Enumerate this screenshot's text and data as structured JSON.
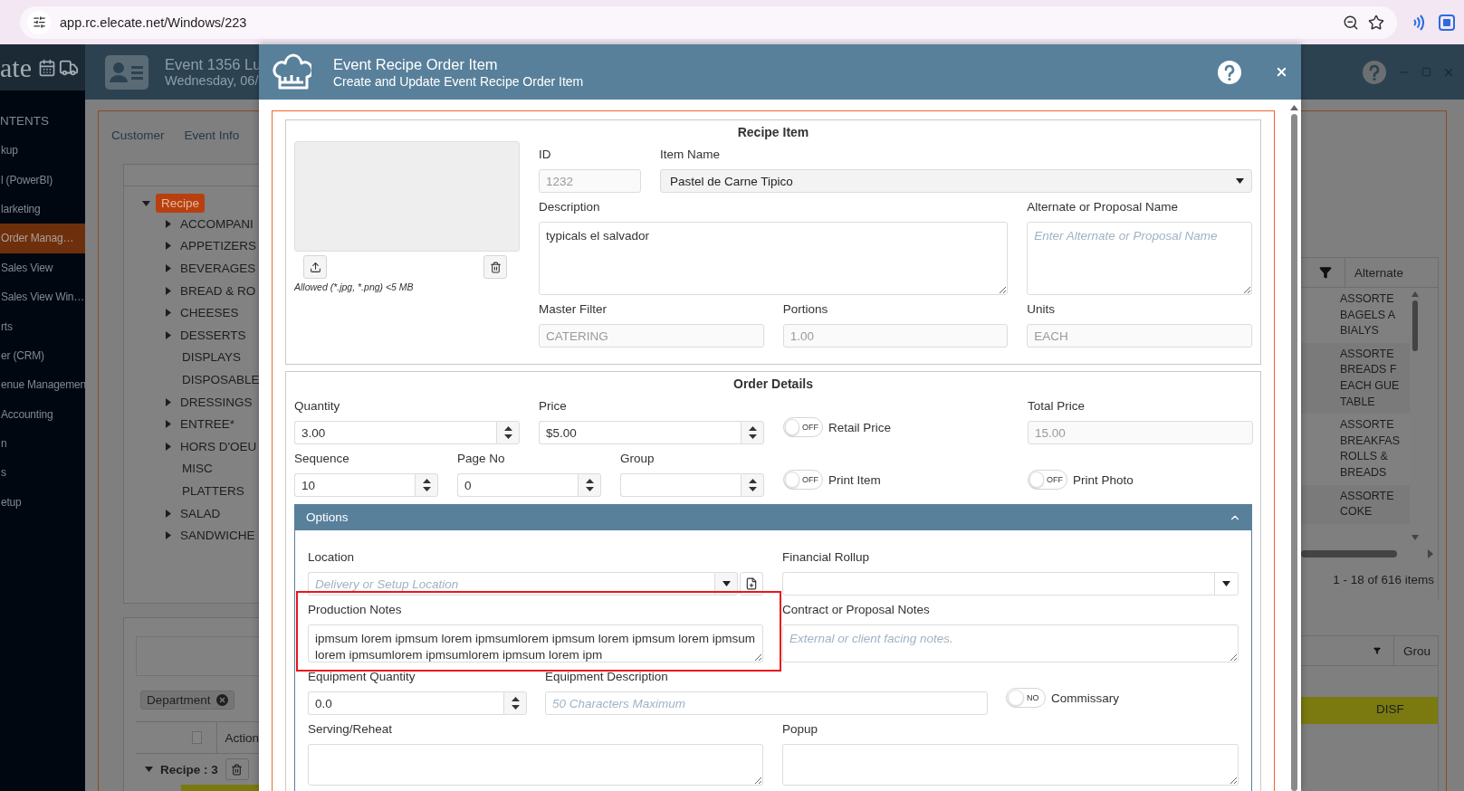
{
  "browser": {
    "url": "app.rc.elecate.net/Windows/223"
  },
  "app": {
    "logo": "ate",
    "event_title": "Event 1356 Lu",
    "event_date": "Wednesday, 06/"
  },
  "sidebar": {
    "heading": "NTENTS",
    "items": [
      {
        "label": "kup",
        "selected": false
      },
      {
        "label": "l (PowerBI)",
        "selected": false
      },
      {
        "label": "larketing",
        "selected": false
      },
      {
        "label": "Order Manag…",
        "selected": true
      },
      {
        "label": "Sales View",
        "selected": false
      },
      {
        "label": "Sales View Win…",
        "selected": false
      },
      {
        "label": "rts",
        "selected": false
      },
      {
        "label": "er (CRM)",
        "selected": false
      },
      {
        "label": "enue Managemen",
        "selected": false
      },
      {
        "label": "Accounting",
        "selected": false
      },
      {
        "label": "n",
        "selected": false
      },
      {
        "label": "s",
        "selected": false
      },
      {
        "label": "etup",
        "selected": false
      }
    ]
  },
  "tabs": [
    {
      "label": "Customer"
    },
    {
      "label": "Event Info"
    }
  ],
  "tree": {
    "label": "Recipe",
    "selected": true,
    "expanded": true,
    "children": [
      {
        "label": "ACCOMPANI",
        "expandable": true
      },
      {
        "label": "APPETIZERS",
        "expandable": true
      },
      {
        "label": "BEVERAGES",
        "expandable": true
      },
      {
        "label": "BREAD & RO",
        "expandable": true
      },
      {
        "label": "CHEESES",
        "expandable": true
      },
      {
        "label": "DESSERTS",
        "expandable": true
      },
      {
        "label": "DISPLAYS",
        "expandable": false
      },
      {
        "label": "DISPOSABLE",
        "expandable": false
      },
      {
        "label": "DRESSINGS",
        "expandable": true
      },
      {
        "label": "ENTREE*",
        "expandable": true
      },
      {
        "label": "HORS D'OEU",
        "expandable": true
      },
      {
        "label": "MISC",
        "expandable": false
      },
      {
        "label": "PLATTERS",
        "expandable": false
      },
      {
        "label": "SALAD",
        "expandable": true
      },
      {
        "label": "SANDWICHE",
        "expandable": true
      }
    ]
  },
  "lower_grid": {
    "filter_chip": "Department",
    "checked": false,
    "column": "Action",
    "group_row": "Recipe : 3"
  },
  "right_grid": {
    "column": "Alternate",
    "rows": [
      {
        "lines": [
          "ASSORTE",
          "BAGELS A",
          "BIALYS"
        ]
      },
      {
        "lines": [
          "ASSORTE",
          "BREADS F",
          "EACH GUE",
          "TABLE"
        ]
      },
      {
        "lines": [
          "ASSORTE",
          "BREAKFAS",
          "ROLLS &",
          "BREADS"
        ]
      },
      {
        "lines": [
          "ASSORTE",
          "COKE"
        ]
      }
    ],
    "pager": "1 - 18 of 616 items",
    "lower_column": "Grou",
    "lower_cell": "DISF"
  },
  "modal": {
    "title": "Event Recipe Order Item",
    "subtitle": "Create and Update Event Recipe Order Item",
    "recipe_item": {
      "heading": "Recipe Item",
      "image_hint": "Allowed (*.jpg, *.png) <5 MB",
      "id": {
        "label": "ID",
        "value": "1232",
        "disabled": true
      },
      "item_name": {
        "label": "Item Name",
        "value": "Pastel de Carne Tipico"
      },
      "description": {
        "label": "Description",
        "value": "typicals el salvador"
      },
      "alternate_name": {
        "label": "Alternate or Proposal Name",
        "placeholder": "Enter Alternate or Proposal Name"
      },
      "master_filter": {
        "label": "Master Filter",
        "value": "CATERING",
        "disabled": true
      },
      "portions": {
        "label": "Portions",
        "value": "1.00",
        "disabled": true
      },
      "units": {
        "label": "Units",
        "value": "EACH",
        "disabled": true
      }
    },
    "order_details": {
      "heading": "Order Details",
      "quantity": {
        "label": "Quantity",
        "value": "3.00"
      },
      "price": {
        "label": "Price",
        "value": "$5.00"
      },
      "retail_price": {
        "label": "Retail Price",
        "state": "OFF",
        "on": false
      },
      "total_price": {
        "label": "Total Price",
        "value": "15.00",
        "disabled": true
      },
      "sequence": {
        "label": "Sequence",
        "value": "10"
      },
      "page_no": {
        "label": "Page No",
        "value": "0"
      },
      "group": {
        "label": "Group"
      },
      "print_item": {
        "label": "Print Item",
        "state": "OFF",
        "on": false
      },
      "print_photo": {
        "label": "Print Photo",
        "state": "OFF",
        "on": false
      }
    },
    "options": {
      "heading": "Options",
      "expanded": true,
      "location": {
        "label": "Location",
        "placeholder": "Delivery or Setup Location"
      },
      "financial_rollup": {
        "label": "Financial Rollup"
      },
      "production_notes": {
        "label": "Production Notes",
        "value": "ipmsum lorem ipmsum lorem ipmsumlorem ipmsum lorem ipmsum lorem ipmsum lorem ipmsumlorem ipmsumlorem ipmsum lorem ipm",
        "highlighted": true
      },
      "contract_notes": {
        "label": "Contract or Proposal Notes",
        "placeholder": "External or client facing notes."
      },
      "equipment_quantity": {
        "label": "Equipment Quantity",
        "value": "0.0"
      },
      "equipment_description": {
        "label": "Equipment Description",
        "placeholder": "50 Characters Maximum"
      },
      "commissary": {
        "label": "Commissary",
        "state": "NO",
        "on": false
      },
      "serving_reheat": {
        "label": "Serving/Reheat"
      },
      "popup": {
        "label": "Popup"
      }
    }
  }
}
